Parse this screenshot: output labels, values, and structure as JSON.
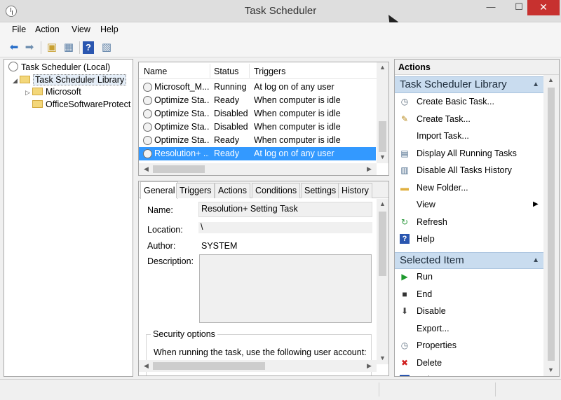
{
  "window": {
    "title": "Task Scheduler",
    "min_glyph": "—",
    "max_glyph": "☐",
    "close_glyph": "✕"
  },
  "menu": [
    "File",
    "Action",
    "View",
    "Help"
  ],
  "toolbar_icons": [
    "back-arrow-icon",
    "forward-arrow-icon",
    "up-folder-icon",
    "console-tree-icon",
    "help-icon",
    "action-pane-icon"
  ],
  "tree": {
    "root": "Task Scheduler (Local)",
    "library": "Task Scheduler Library",
    "children": [
      "Microsoft",
      "OfficeSoftwareProtect"
    ]
  },
  "tasklist": {
    "columns": [
      "Name",
      "Status",
      "Triggers"
    ],
    "rows": [
      {
        "name": "Microsoft_M...",
        "status": "Running",
        "trigger": "At log on of any user"
      },
      {
        "name": "Optimize Sta...",
        "status": "Ready",
        "trigger": "When computer is idle"
      },
      {
        "name": "Optimize Sta...",
        "status": "Disabled",
        "trigger": "When computer is idle"
      },
      {
        "name": "Optimize Sta...",
        "status": "Disabled",
        "trigger": "When computer is idle"
      },
      {
        "name": "Optimize Sta...",
        "status": "Ready",
        "trigger": "When computer is idle"
      },
      {
        "name": "Resolution+ ...",
        "status": "Ready",
        "trigger": "At log on of any user"
      }
    ],
    "selected_index": 5
  },
  "details": {
    "tabs": [
      "General",
      "Triggers",
      "Actions",
      "Conditions",
      "Settings",
      "History"
    ],
    "active_tab": "General",
    "name_label": "Name:",
    "name_value": "Resolution+ Setting Task",
    "location_label": "Location:",
    "location_value": "\\",
    "author_label": "Author:",
    "author_value": "SYSTEM",
    "description_label": "Description:",
    "description_value": "",
    "security_group": "Security options",
    "security_text": "When running the task, use the following user account:"
  },
  "actions": {
    "header": "Actions",
    "section1": "Task Scheduler Library",
    "items1": [
      {
        "label": "Create Basic Task...",
        "icon": "create-basic-task-icon",
        "glyph": "◷",
        "color": "#5a6b7c"
      },
      {
        "label": "Create Task...",
        "icon": "create-task-icon",
        "glyph": "✎",
        "color": "#b88a1e"
      },
      {
        "label": "Import Task...",
        "icon": "",
        "glyph": "",
        "color": "#000"
      },
      {
        "label": "Display All Running Tasks",
        "icon": "running-tasks-icon",
        "glyph": "▤",
        "color": "#4a6a8a"
      },
      {
        "label": "Disable All Tasks History",
        "icon": "history-icon",
        "glyph": "▥",
        "color": "#4a6a8a"
      },
      {
        "label": "New Folder...",
        "icon": "new-folder-icon",
        "glyph": "▬",
        "color": "#e0b040"
      },
      {
        "label": "View",
        "icon": "",
        "glyph": "",
        "color": "#000",
        "submenu": "▶"
      },
      {
        "label": "Refresh",
        "icon": "refresh-icon",
        "glyph": "↻",
        "color": "#2e9a3e"
      },
      {
        "label": "Help",
        "icon": "help-icon",
        "glyph": "?",
        "color": "#ffffff",
        "bg": "#2a56b0"
      }
    ],
    "section2": "Selected Item",
    "items2": [
      {
        "label": "Run",
        "icon": "run-icon",
        "glyph": "▶",
        "color": "#1e9a2e"
      },
      {
        "label": "End",
        "icon": "end-icon",
        "glyph": "■",
        "color": "#333333"
      },
      {
        "label": "Disable",
        "icon": "disable-icon",
        "glyph": "⬇",
        "color": "#444444"
      },
      {
        "label": "Export...",
        "icon": "",
        "glyph": "",
        "color": "#000"
      },
      {
        "label": "Properties",
        "icon": "properties-icon",
        "glyph": "◷",
        "color": "#6a7a8a"
      },
      {
        "label": "Delete",
        "icon": "delete-icon",
        "glyph": "✖",
        "color": "#d02020"
      },
      {
        "label": "Help",
        "icon": "help-icon",
        "glyph": "?",
        "color": "#ffffff",
        "bg": "#2a56b0"
      }
    ]
  }
}
